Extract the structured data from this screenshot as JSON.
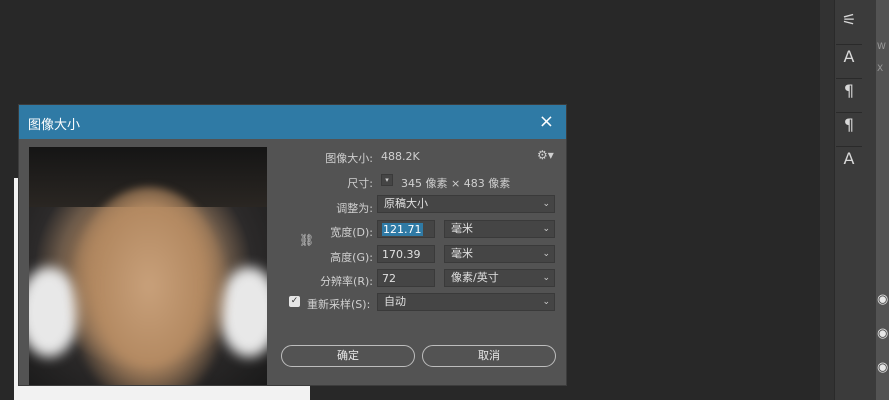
{
  "dialog": {
    "title": "图像大小",
    "close_icon": "×",
    "image_size_label": "图像大小:",
    "image_size_value": "488.2K",
    "dimensions_label": "尺寸:",
    "dimensions_value": "345 像素 × 483 像素",
    "fit_to_label": "调整为:",
    "fit_to_value": "原稿大小",
    "width_label": "宽度(D):",
    "width_value": "121.71",
    "width_unit": "毫米",
    "height_label": "高度(G):",
    "height_value": "170.39",
    "height_unit": "毫米",
    "resolution_label": "分辨率(R):",
    "resolution_value": "72",
    "resolution_unit": "像素/英寸",
    "resample_label": "重新采样(S):",
    "resample_value": "自动",
    "resample_checked": true,
    "ok_label": "确定",
    "cancel_label": "取消"
  },
  "right_panel": {
    "tools": [
      "sliders-icon",
      "character-style-icon",
      "paragraph-style-icon",
      "pilcrow-icon",
      "text-icon"
    ],
    "side_letters": [
      "W",
      "X"
    ]
  }
}
